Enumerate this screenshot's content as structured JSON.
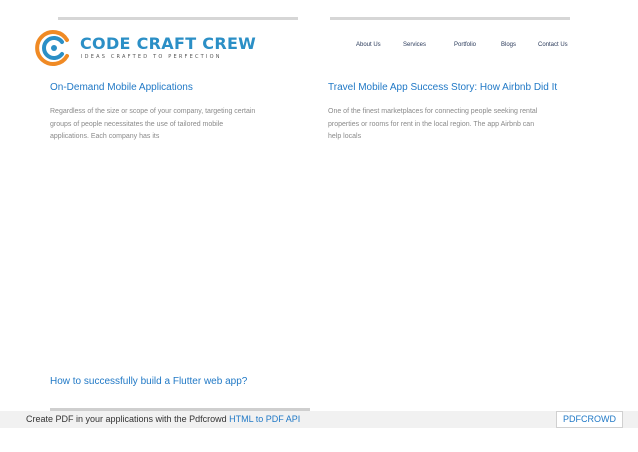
{
  "brand": {
    "name": "CODE CRAFT CREW",
    "tagline": "IDEAS CRAFTED TO PERFECTION",
    "colors": {
      "primary": "#2b8fc6",
      "accent": "#f08a24"
    }
  },
  "nav": {
    "items": [
      "About Us",
      "Services",
      "Portfolio",
      "Blogs",
      "Contact Us"
    ]
  },
  "posts": [
    {
      "title": "On-Demand Mobile Applications",
      "excerpt_lines": [
        "Regardless of the size or scope of your company, targeting certain",
        "groups of people necessitates the use of tailored mobile",
        "applications. Each company has its"
      ]
    },
    {
      "title": "Travel Mobile App Success Story: How Airbnb Did It",
      "excerpt_lines": [
        "One of the finest marketplaces for connecting people seeking rental",
        "properties or rooms for rent in the local region. The app Airbnb can",
        "help locals"
      ]
    },
    {
      "title": "How to successfully build a Flutter web app?"
    }
  ],
  "footer": {
    "text": "Create PDF in your applications with the Pdfcrowd",
    "link": "HTML to PDF API",
    "brand": "PDFCROWD"
  }
}
